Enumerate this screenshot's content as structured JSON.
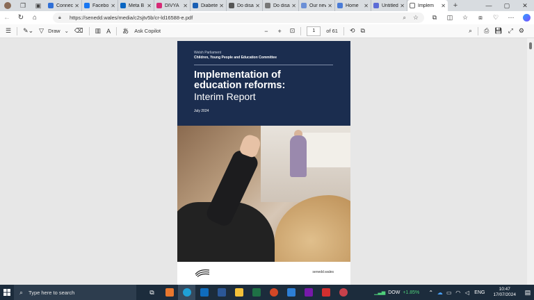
{
  "tabs": [
    {
      "label": "Connec",
      "color": "#2f6fd6"
    },
    {
      "label": "Facebo",
      "color": "#1877f2"
    },
    {
      "label": "Meta B",
      "color": "#0a66c2"
    },
    {
      "label": "DIVYA",
      "color": "#d62976"
    },
    {
      "label": "Diabete",
      "color": "#1a5fb4"
    },
    {
      "label": "Do disa",
      "color": "#555555"
    },
    {
      "label": "Do disa",
      "color": "#777777"
    },
    {
      "label": "Our nev",
      "color": "#6b8fd6"
    },
    {
      "label": "Home",
      "color": "#4a7bd6"
    },
    {
      "label": "Untitled",
      "color": "#5b6bd6"
    },
    {
      "label": "Implem",
      "color": "#ffffff",
      "active": true
    }
  ],
  "address": {
    "url": "https://senedd.wales/media/c2sjtv5b/cr-ld16588-e.pdf"
  },
  "pdf_toolbar": {
    "draw_label": "Draw",
    "copilot_label": "Ask Copilot",
    "page_current": "1",
    "page_total": "of 61"
  },
  "document": {
    "org": "Welsh Parliament",
    "committee": "Children, Young People and Education Committee",
    "title_line1": "Implementation of",
    "title_line2": "education reforms:",
    "subtitle": "Interim Report",
    "date": "July 2024",
    "footer_site": "senedd.wales"
  },
  "taskbar": {
    "search_placeholder": "Type here to search",
    "ticker_name": "DOW",
    "ticker_change": "+1.85%",
    "lang": "ENG",
    "time": "10:47",
    "date": "17/07/2024"
  },
  "colors": {
    "cover_navy": "#1b2d4f",
    "taskbar": "#1c2c3c"
  }
}
